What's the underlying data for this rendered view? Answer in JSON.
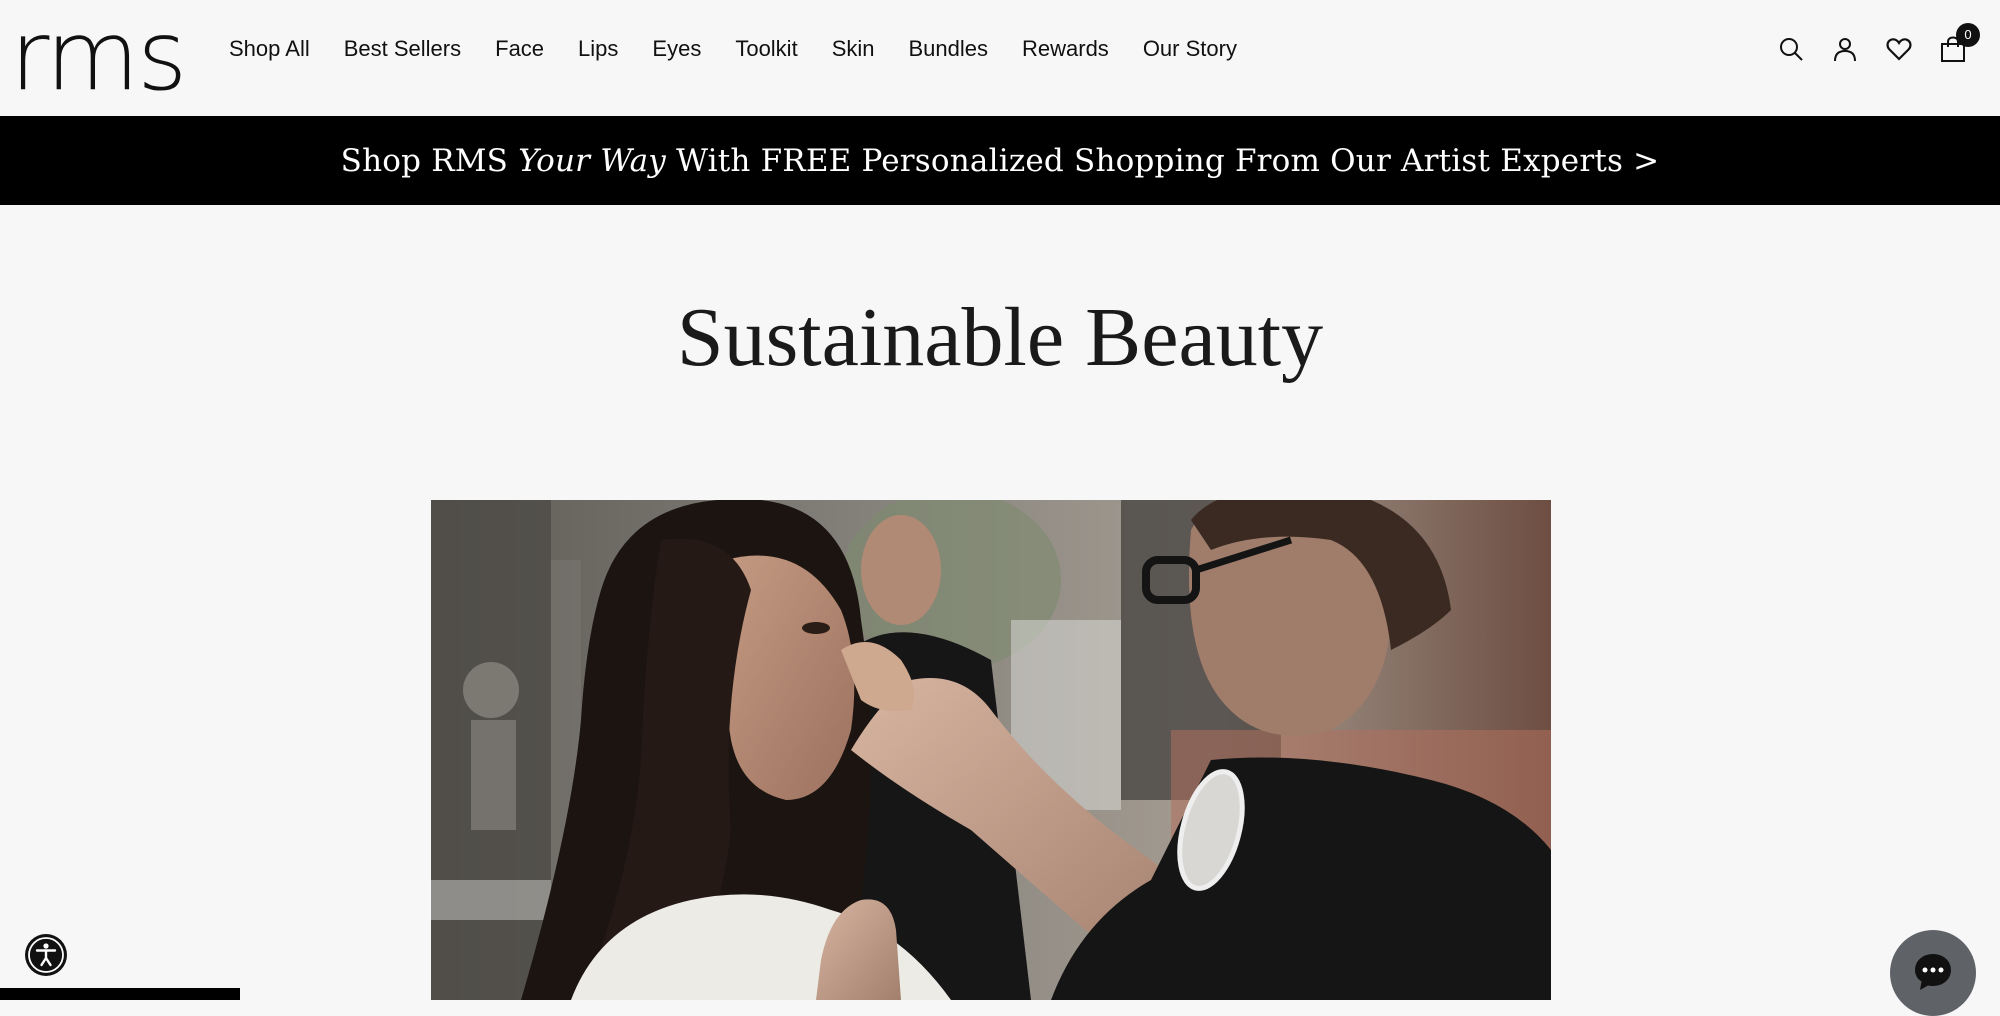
{
  "header": {
    "logo": "rms",
    "nav": [
      "Shop All",
      "Best Sellers",
      "Face",
      "Lips",
      "Eyes",
      "Toolkit",
      "Skin",
      "Bundles",
      "Rewards",
      "Our Story"
    ],
    "icons": [
      "search-icon",
      "account-icon",
      "wishlist-heart-icon",
      "cart-icon"
    ],
    "cart_count": "0"
  },
  "banner": {
    "text_before": "Shop RMS ",
    "text_italic": "Your Way",
    "text_after": " With FREE Personalized Shopping From Our Artist Experts >"
  },
  "main": {
    "title": "Sustainable Beauty",
    "hero_icon": "photo-makeup-artist-applying-makeup"
  },
  "widgets": {
    "accessibility_icon": "accessibility-icon",
    "chat_icon": "chat-bubble-icon"
  },
  "colors": {
    "background": "#f7f7f7",
    "banner_bg": "#000000",
    "banner_text": "#ffffff",
    "text": "#111111",
    "chat_bg": "#5f6368"
  }
}
